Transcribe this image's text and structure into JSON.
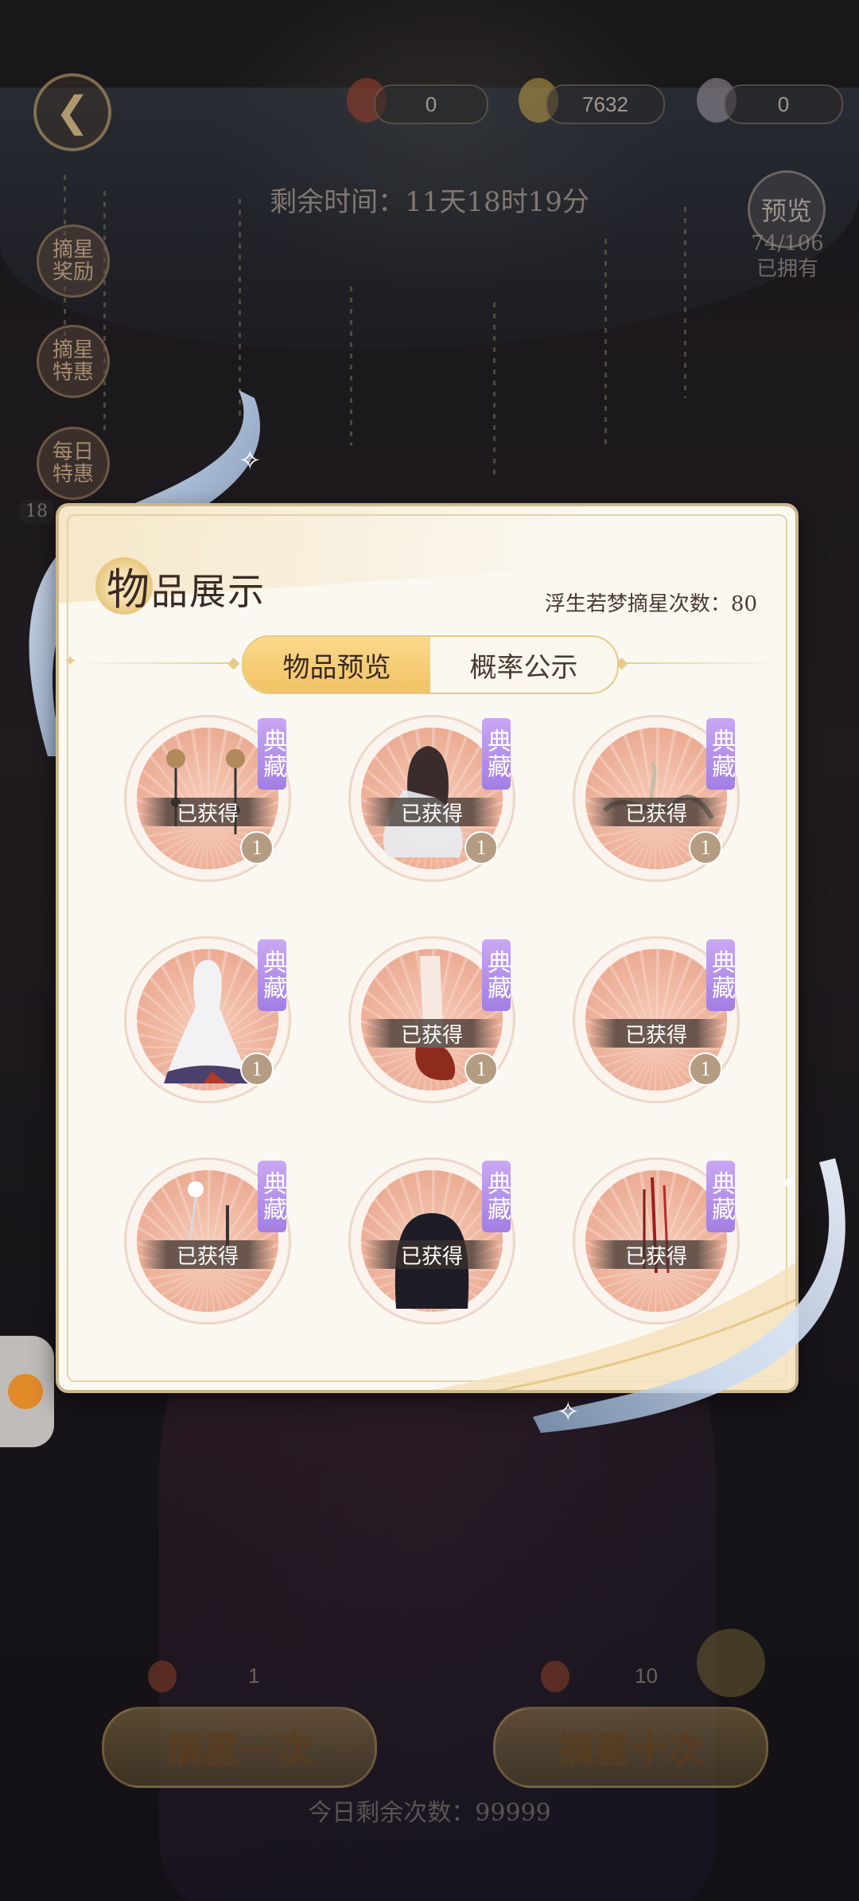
{
  "top_bar": {
    "currencies": [
      {
        "icon": "red-lantern-icon",
        "value": "0"
      },
      {
        "icon": "gold-coin-icon",
        "value": "7632"
      },
      {
        "icon": "pearl-icon",
        "value": "0"
      }
    ],
    "timer_text": "剩余时间：11天18时19分",
    "preview_label": "预览",
    "owned_count": "74/106",
    "owned_label": "已拥有"
  },
  "side_menu": [
    {
      "label": "摘星奖励"
    },
    {
      "label": "摘星特惠"
    },
    {
      "label": "每日特惠"
    }
  ],
  "side_tag": "18",
  "modal": {
    "title_first": "物",
    "title_rest": "品展示",
    "draw_count_label": "浮生若梦摘星次数：80",
    "tabs": [
      {
        "label": "物品预览",
        "active": true
      },
      {
        "label": "概率公示",
        "active": false
      }
    ],
    "items": [
      {
        "tag": "典藏",
        "status": "已获得",
        "qty": "1",
        "art": "earrings"
      },
      {
        "tag": "典藏",
        "status": "已获得",
        "qty": "1",
        "art": "hair"
      },
      {
        "tag": "典藏",
        "status": "已获得",
        "qty": "1",
        "art": "ribbon"
      },
      {
        "tag": "典藏",
        "status": "已获得",
        "qty": "1",
        "art": "dress"
      },
      {
        "tag": "典藏",
        "status": "已获得",
        "qty": "1",
        "art": "shoes"
      },
      {
        "tag": "典藏",
        "status": "已获得",
        "qty": "1",
        "art": "empty"
      },
      {
        "tag": "典藏",
        "status": "已获得",
        "qty": "",
        "art": "hairpin"
      },
      {
        "tag": "典藏",
        "status": "已获得",
        "qty": "",
        "art": "black-hair"
      },
      {
        "tag": "典藏",
        "status": "已获得",
        "qty": "",
        "art": "red-tassel"
      }
    ]
  },
  "bottom": {
    "pull_one": {
      "label": "摘星一次",
      "cost": "1"
    },
    "pull_ten": {
      "label": "摘星十次",
      "cost": "10"
    },
    "remaining_text": "今日剩余次数：99999"
  },
  "colors": {
    "accent_gold": "#f1c266",
    "tag_purple": "#a27ee3",
    "disc_peach": "#eaa88f",
    "modal_bg": "#fbf8f2"
  }
}
